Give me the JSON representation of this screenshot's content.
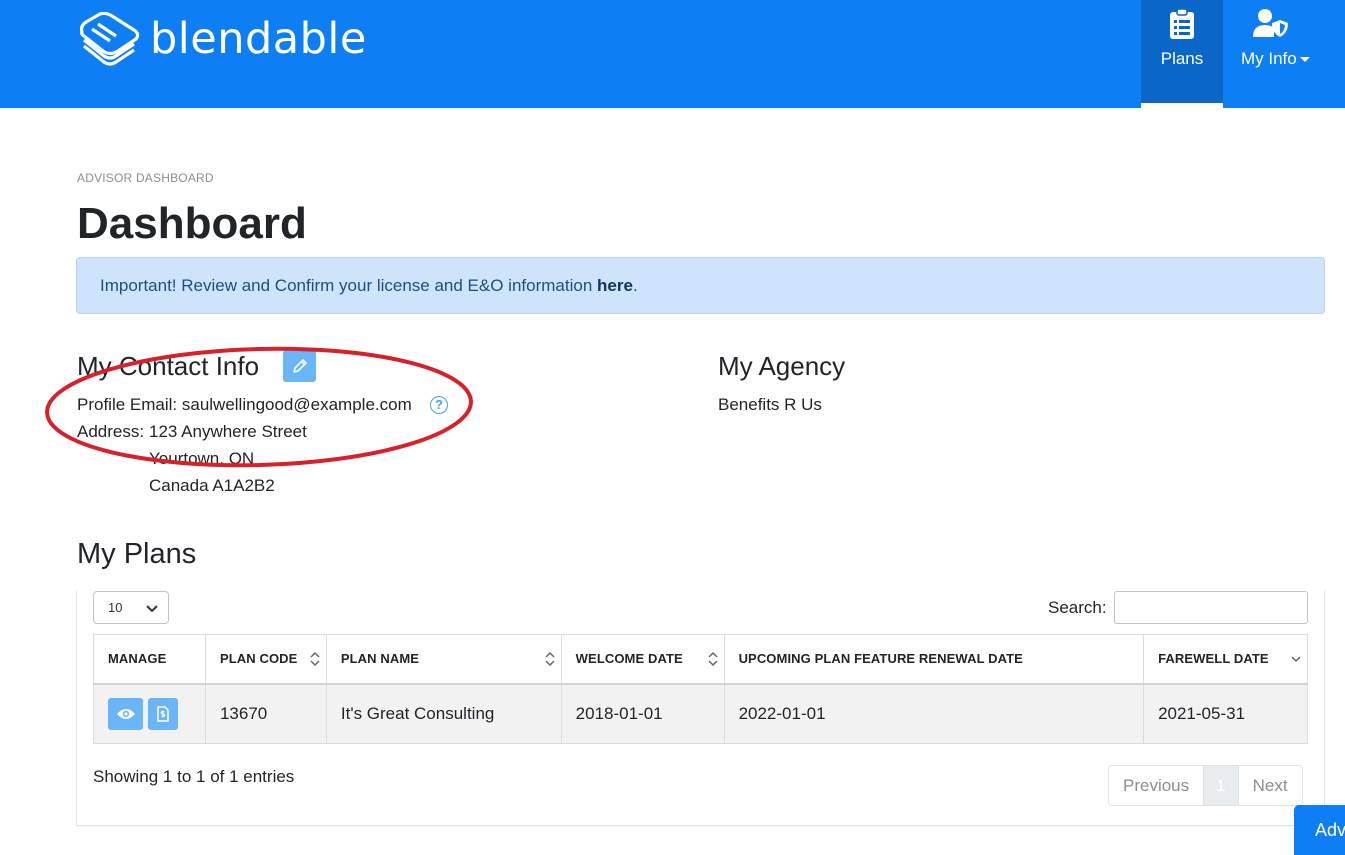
{
  "header": {
    "brand": "blendable",
    "nav": {
      "plans_label": "Plans",
      "myinfo_label": "My Info"
    }
  },
  "breadcrumb": "ADVISOR DASHBOARD",
  "page_title": "Dashboard",
  "alert": {
    "prefix": "Important! Review and Confirm your license and E&O information ",
    "link": "here",
    "suffix": "."
  },
  "contact": {
    "heading": "My Contact Info",
    "email_line": "Profile Email: saulwellingood@example.com",
    "address_label": "Address:",
    "address_lines": [
      "123 Anywhere Street",
      "Yourtown, ON",
      "Canada A1A2B2"
    ]
  },
  "agency": {
    "heading": "My Agency",
    "name": "Benefits R Us"
  },
  "plans": {
    "heading": "My Plans",
    "page_length": "10",
    "search_label": "Search:",
    "columns": [
      "MANAGE",
      "PLAN CODE",
      "PLAN NAME",
      "WELCOME DATE",
      "UPCOMING PLAN FEATURE RENEWAL DATE",
      "FAREWELL DATE"
    ],
    "rows": [
      {
        "plan_code": "13670",
        "plan_name": "It's Great Consulting",
        "welcome_date": "2018-01-01",
        "renewal_date": "2022-01-01",
        "farewell_date": "2021-05-31"
      }
    ],
    "info": "Showing 1 to 1 of 1 entries",
    "pagination": {
      "previous": "Previous",
      "page": "1",
      "next": "Next"
    }
  },
  "floating_button": "Adv",
  "colors": {
    "primary": "#0d7ef3",
    "alert_bg": "#cfe4fc",
    "button_light": "#6ab4f8",
    "annotation": "#d8202a"
  },
  "icons": [
    "clipboard-icon",
    "user-shield-icon",
    "pencil-icon",
    "question-circle-icon",
    "eye-icon",
    "document-dollar-icon"
  ]
}
